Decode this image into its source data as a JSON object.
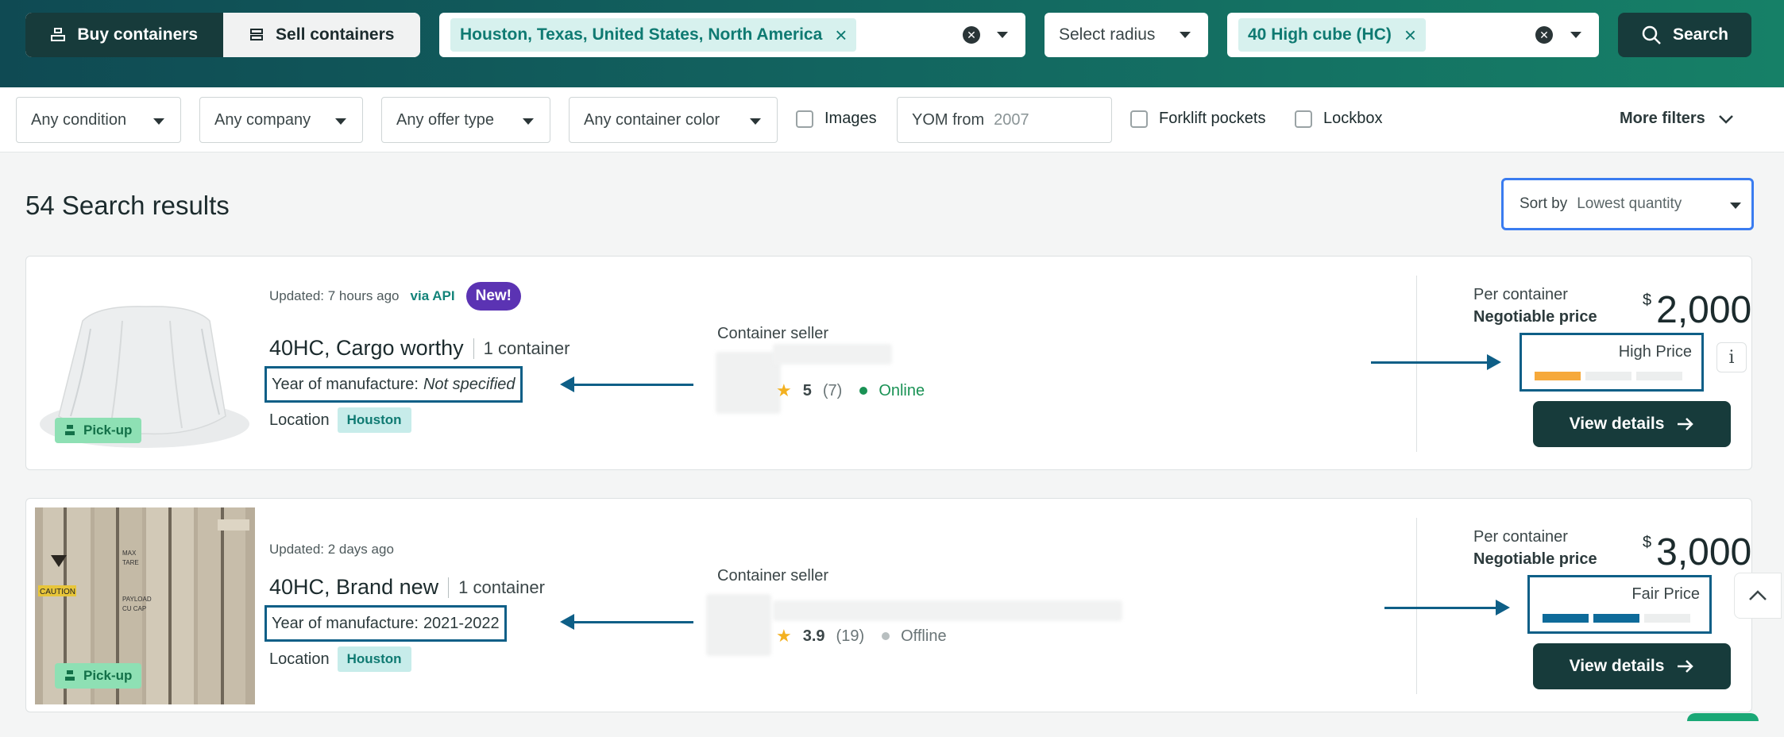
{
  "header": {
    "buy_label": "Buy containers",
    "sell_label": "Sell containers",
    "location_chip": "Houston, Texas, United States, North America",
    "radius_placeholder": "Select radius",
    "type_chip": "40 High cube (HC)",
    "search_label": "Search"
  },
  "filters": {
    "condition": "Any condition",
    "company": "Any company",
    "offer_type": "Any offer type",
    "color": "Any container color",
    "images": "Images",
    "yom_label": "YOM from",
    "yom_value": "2007",
    "forklift": "Forklift pockets",
    "lockbox": "Lockbox",
    "more": "More filters"
  },
  "results": {
    "title": "54 Search results",
    "sort_label": "Sort by",
    "sort_value": "Lowest quantity"
  },
  "listings": [
    {
      "updated": "Updated: 7 hours ago",
      "via": "via API",
      "badge": "New!",
      "title": "40HC, Cargo worthy",
      "qty": "1 container",
      "yom_label": "Year of manufacture:",
      "yom_value": "Not specified",
      "location_label": "Location",
      "location": "Houston",
      "pickup": "Pick-up",
      "seller_label": "Container seller",
      "rating": "5",
      "reviews": "(7)",
      "status": "Online",
      "per_label": "Per container",
      "negotiable": "Negotiable price",
      "currency": "$",
      "price": "2,000",
      "price_rating": "High Price",
      "price_level": 1,
      "view_label": "View details"
    },
    {
      "updated": "Updated: 2 days ago",
      "title": "40HC, Brand new",
      "qty": "1 container",
      "yom_label": "Year of manufacture:",
      "yom_value": "2021-2022",
      "location_label": "Location",
      "location": "Houston",
      "pickup": "Pick-up",
      "seller_label": "Container seller",
      "rating": "3.9",
      "reviews": "(19)",
      "status": "Offline",
      "per_label": "Per container",
      "negotiable": "Negotiable price",
      "currency": "$",
      "price": "3,000",
      "price_rating": "Fair Price",
      "price_level": 2,
      "view_label": "View details"
    }
  ],
  "container_image_text": [
    "CAUTION",
    "MAX",
    "TARE",
    "PAYLOAD",
    "CU CAP"
  ],
  "colors": {
    "brand_dark": "#173b3b",
    "accent_teal": "#0f7a72",
    "high_price": "#f6a93b",
    "fair_price": "#0e6b9a",
    "highlight_box": "#0e5f87"
  }
}
